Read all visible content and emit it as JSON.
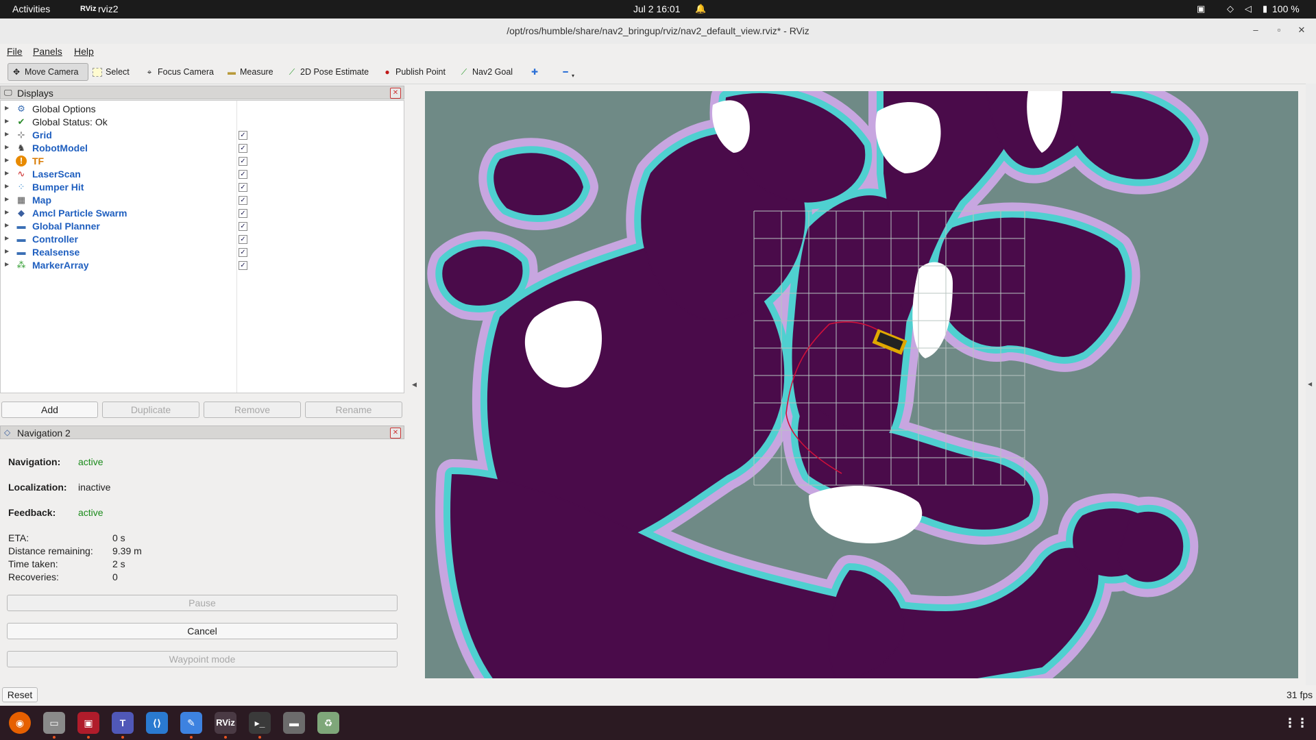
{
  "topbar": {
    "activities": "Activities",
    "app": "rviz2",
    "app_icon": "RViz",
    "clock": "Jul 2  16:01",
    "battery": "100 %"
  },
  "window": {
    "title": "/opt/ros/humble/share/nav2_bringup/rviz/nav2_default_view.rviz* - RViz"
  },
  "menu": {
    "file": "File",
    "panels": "Panels",
    "help": "Help"
  },
  "toolbar": {
    "move_camera": "Move Camera",
    "select": "Select",
    "focus_camera": "Focus Camera",
    "measure": "Measure",
    "pose_estimate": "2D Pose Estimate",
    "publish_point": "Publish Point",
    "nav2_goal": "Nav2 Goal"
  },
  "displays": {
    "title": "Displays",
    "items": [
      {
        "label": "Global Options",
        "style": "plain",
        "icon": "gear-icon",
        "checked": null
      },
      {
        "label": "Global Status: Ok",
        "style": "plain",
        "icon": "check-icon",
        "checked": null
      },
      {
        "label": "Grid",
        "style": "blue",
        "icon": "grid-icon",
        "checked": true
      },
      {
        "label": "RobotModel",
        "style": "blue",
        "icon": "robot-icon",
        "checked": true
      },
      {
        "label": "TF",
        "style": "orange",
        "icon": "warning-icon",
        "checked": true
      },
      {
        "label": "LaserScan",
        "style": "blue",
        "icon": "laser-icon",
        "checked": true
      },
      {
        "label": "Bumper Hit",
        "style": "blue",
        "icon": "points-icon",
        "checked": true
      },
      {
        "label": "Map",
        "style": "blue",
        "icon": "map-icon",
        "checked": true
      },
      {
        "label": "Amcl Particle Swarm",
        "style": "blue",
        "icon": "diamond-icon",
        "checked": true
      },
      {
        "label": "Global Planner",
        "style": "blue",
        "icon": "folder-icon",
        "checked": true
      },
      {
        "label": "Controller",
        "style": "blue",
        "icon": "folder-icon",
        "checked": true
      },
      {
        "label": "Realsense",
        "style": "blue",
        "icon": "folder-icon",
        "checked": true
      },
      {
        "label": "MarkerArray",
        "style": "blue",
        "icon": "markers-icon",
        "checked": true
      }
    ],
    "buttons": {
      "add": "Add",
      "duplicate": "Duplicate",
      "remove": "Remove",
      "rename": "Rename"
    }
  },
  "nav2": {
    "title": "Navigation 2",
    "navigation_label": "Navigation:",
    "navigation_value": "active",
    "localization_label": "Localization:",
    "localization_value": "inactive",
    "feedback_label": "Feedback:",
    "feedback_value": "active",
    "eta_label": "ETA:",
    "eta_value": "0 s",
    "distance_label": "Distance remaining:",
    "distance_value": "9.39 m",
    "time_label": "Time taken:",
    "time_value": "2 s",
    "recoveries_label": "Recoveries:",
    "recoveries_value": "0",
    "pause": "Pause",
    "cancel": "Cancel",
    "waypoint": "Waypoint mode"
  },
  "status": {
    "reset": "Reset",
    "fps": "31 fps"
  },
  "colors": {
    "unknown": "#6f8a86",
    "obstacle": "#4a0b4a",
    "inflation_inner": "#4fd0d0",
    "inflation_outer": "#c7a6e0",
    "free": "#ffffff",
    "path": "#d0103a"
  }
}
